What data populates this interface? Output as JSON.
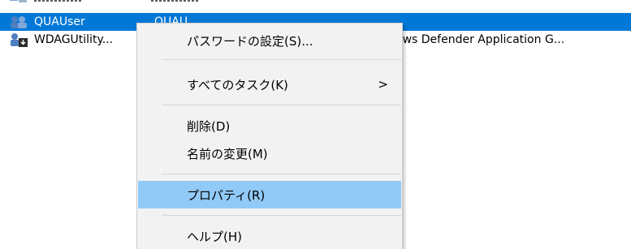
{
  "list": {
    "partial_row": {
      "icon": "user-icon",
      "name": "",
      "fullname": ""
    },
    "selected_row": {
      "icon": "user-icon",
      "name": "QUAUser",
      "fullname": "QUAU"
    },
    "wdag_row": {
      "icon": "user-download-icon",
      "name": "WDAGUtility...",
      "description": "ows Defender Application G..."
    }
  },
  "context_menu": {
    "items": [
      {
        "label": "パスワードの設定(S)..."
      },
      {
        "label": "すべてのタスク(K)",
        "submenu_arrow": ">"
      },
      {
        "label": "削除(D)"
      },
      {
        "label": "名前の変更(M)"
      },
      {
        "label": "プロパティ(R)"
      },
      {
        "label": "ヘルプ(H)"
      }
    ],
    "highlighted_index": 4
  },
  "colors": {
    "selection": "#0078d7",
    "menu_background": "#f2f2f2",
    "menu_highlight": "#91c9f7"
  }
}
